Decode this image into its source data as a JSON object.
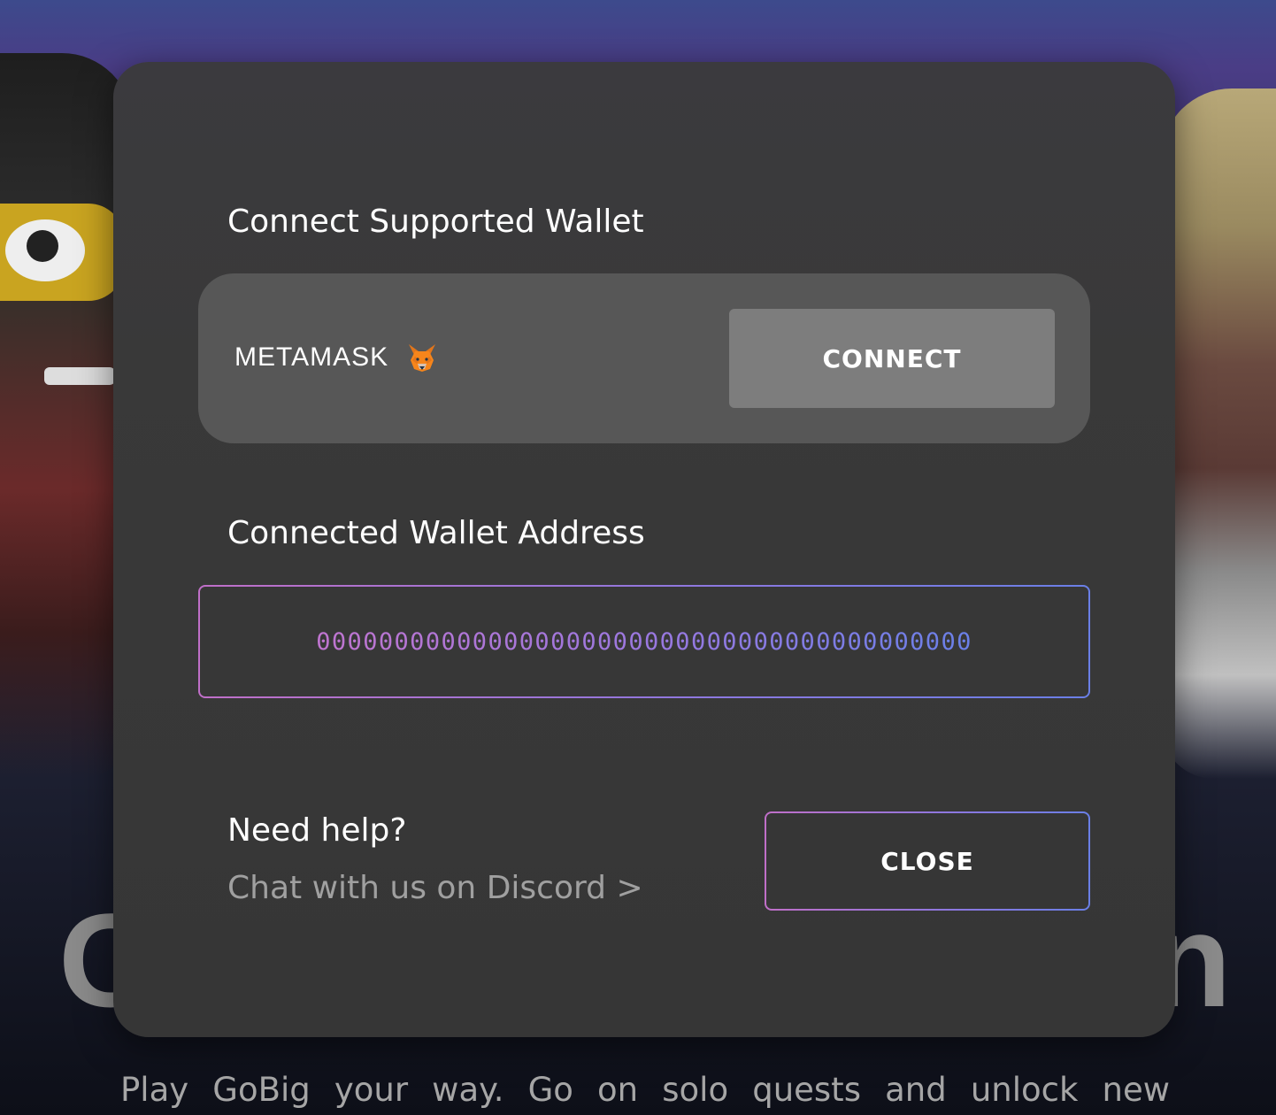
{
  "background": {
    "title_fragment_left": "G",
    "title_fragment_right": "n",
    "subtitle": "Play GoBig your way. Go on solo quests and unlock new"
  },
  "modal": {
    "supported_title": "Connect Supported Wallet",
    "wallet": {
      "name": "METAMASK",
      "icon": "metamask-fox-icon",
      "connect_label": "CONNECT"
    },
    "address_title": "Connected Wallet Address",
    "address_value": "000000000000000000000000000000000000000000",
    "help": {
      "title": "Need help?",
      "link_text": "Chat with us on Discord >"
    },
    "close_label": "CLOSE"
  },
  "colors": {
    "modal_bg": "#393939",
    "card_bg": "#575757",
    "connect_btn_bg": "#7d7d7d",
    "gradient_start": "#c06fc8",
    "gradient_end": "#6a7fe6",
    "muted_text": "#a0a0a0"
  }
}
